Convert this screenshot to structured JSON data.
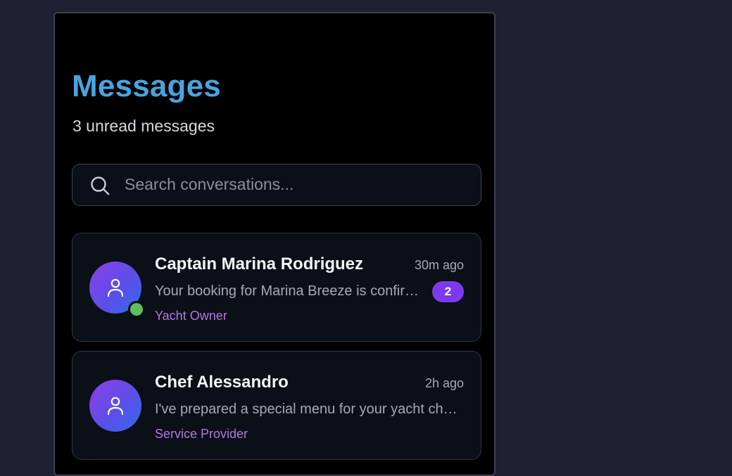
{
  "header": {
    "title": "Messages",
    "subtitle": "3 unread messages"
  },
  "search": {
    "placeholder": "Search conversations...",
    "icon": "search-icon"
  },
  "conversations": [
    {
      "name": "Captain Marina Rodriguez",
      "time": "30m ago",
      "preview": "Your booking for Marina Breeze is confirmed",
      "unread": "2",
      "role": "Yacht Owner",
      "online": true,
      "avatar_icon": "user-icon"
    },
    {
      "name": "Chef Alessandro",
      "time": "2h ago",
      "preview": "I've prepared a special menu for your yacht charter",
      "role": "Service Provider",
      "online": false,
      "avatar_icon": "user-icon"
    }
  ],
  "colors": {
    "page_background": "#1e2131",
    "panel_background": "#000000",
    "title": "#4aa3df",
    "accent": "#7c3aed",
    "role_text": "#b07ae0",
    "online": "#5cbf5c"
  }
}
